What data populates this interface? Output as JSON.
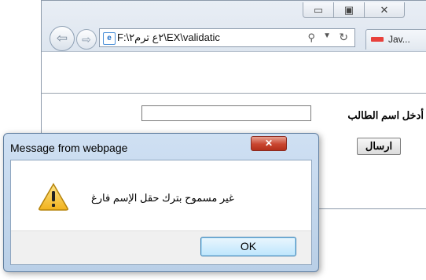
{
  "browser": {
    "window_controls": {
      "minimize": "▭",
      "maximize": "▣",
      "close": "✕"
    },
    "nav": {
      "back_glyph": "⇦",
      "forward_glyph": "⇨"
    },
    "address": {
      "url": "F:\\٢ع ترم٢\\EX\\validatic",
      "search_glyph": "⚲",
      "dropdown_glyph": "▼",
      "refresh_glyph": "↻",
      "page_icon": "e"
    },
    "tab": {
      "label": "Jav...",
      "icon_color": "#e8413c"
    }
  },
  "page": {
    "name_label": "أدخل اسم الطالب",
    "name_value": "",
    "send_button": "ارسال"
  },
  "dialog": {
    "title": "Message from webpage",
    "close_glyph": "✕",
    "message": "غير مسموح بترك حقل الإسم فارغ",
    "ok_button": "OK",
    "icon": "warning-icon"
  }
}
